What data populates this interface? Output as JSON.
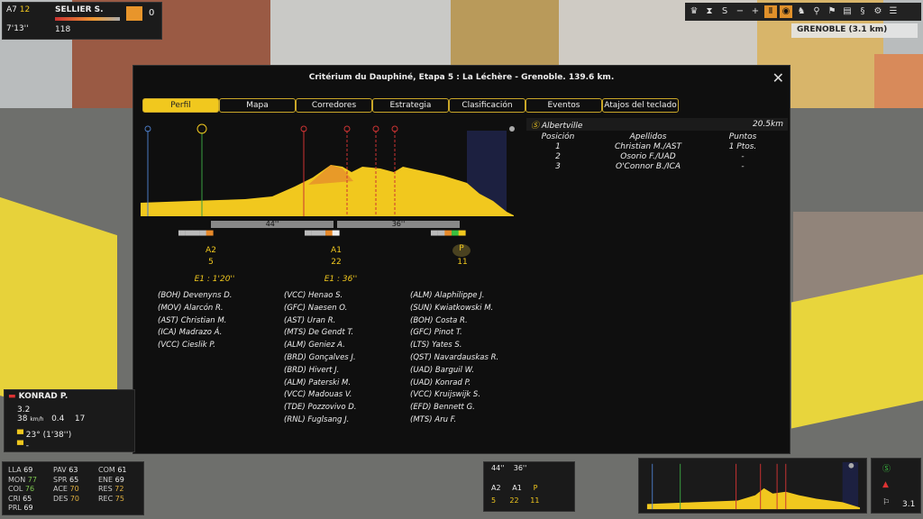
{
  "top_hud": {
    "group": "A7",
    "group_count": "12",
    "rider_name": "SELLIER S.",
    "gap": "7'13''",
    "energy": "118",
    "number": "0"
  },
  "location": "GRENOBLE (3.1 km)",
  "panel": {
    "title": "Critérium du Dauphiné, Etapa 5 : La Léchère - Grenoble. 139.6 km.",
    "tabs": [
      "Perfil",
      "Mapa",
      "Corredores",
      "Estrategia",
      "Clasificación",
      "Eventos",
      "Atajos del teclado"
    ],
    "gaps": [
      "44''",
      "36''"
    ],
    "groups": [
      {
        "label": "A2",
        "count": "5",
        "time": "E1 : 1'20''"
      },
      {
        "label": "A1",
        "count": "22",
        "time": "E1 : 36''"
      },
      {
        "label": "P",
        "count": "11"
      }
    ],
    "columns": [
      [
        "(BOH) Devenyns D.",
        "(MOV) Alarcón R.",
        "(AST) Christian M.",
        "(ICA) Madrazo Á.",
        "(VCC) Cieslik P."
      ],
      [
        "(VCC) Henao S.",
        "(GFC) Naesen O.",
        "(AST) Uran R.",
        "(MTS) De Gendt T.",
        "(ALM) Geniez A.",
        "(BRD) Gonçalves J.",
        "(BRD) Hivert J.",
        "(ALM) Paterski M.",
        "(VCC) Madouas V.",
        "(TDE) Pozzovivo D.",
        "(RNL) Fuglsang J."
      ],
      [
        "(ALM) Alaphilippe J.",
        "(SUN) Kwiatkowski M.",
        "(BOH) Costa R.",
        "(GFC) Pinot T.",
        "(LTS) Yates S.",
        "(QST) Navardauskas R.",
        "(UAD) Barguil W.",
        "(UAD) Konrad P.",
        "(VCC) Kruijswijk S.",
        "(EFD) Bennett G.",
        "(MTS) Aru F."
      ]
    ],
    "sprint": {
      "name": "Albertville",
      "distance": "20.5km",
      "headers": [
        "Posición",
        "Apellidos",
        "Puntos"
      ],
      "rows": [
        [
          "1",
          "Christian M./AST",
          "1 Ptos."
        ],
        [
          "2",
          "Osorio F./UAD",
          "-"
        ],
        [
          "3",
          "O'Connor B./ICA",
          "-"
        ]
      ]
    }
  },
  "rider_hud": {
    "name": "KONRAD P.",
    "v1": "3.2",
    "v2": "38",
    "unit": "km/h",
    "grad": "0.4",
    "n": "17",
    "pos": "23° (1'38'')",
    "extra": "-"
  },
  "stats": [
    [
      "LLA",
      "69"
    ],
    [
      "PAV",
      "63"
    ],
    [
      "COM",
      "61"
    ],
    [
      "MON",
      "77"
    ],
    [
      "SPR",
      "65"
    ],
    [
      "ENE",
      "69"
    ],
    [
      "COL",
      "76"
    ],
    [
      "ACE",
      "70"
    ],
    [
      "RES",
      "72"
    ],
    [
      "CRI",
      "65"
    ],
    [
      "DES",
      "70"
    ],
    [
      "REC",
      "75"
    ],
    [
      "PRL",
      "69"
    ]
  ],
  "mini": {
    "gaps": [
      "44''",
      "36''"
    ],
    "labels": [
      "A2",
      "A1",
      "P"
    ],
    "counts": [
      "5",
      "22",
      "11"
    ],
    "right_value": "3.1"
  }
}
